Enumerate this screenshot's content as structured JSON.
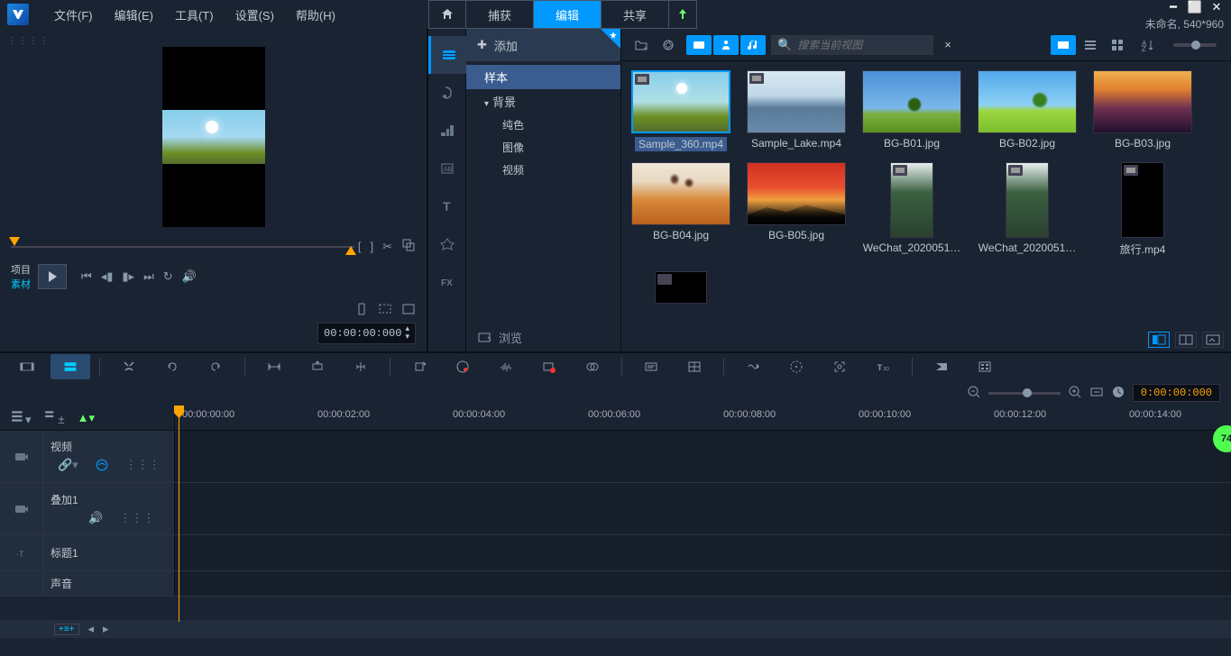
{
  "menubar": {
    "file": "文件(F)",
    "edit": "编辑(E)",
    "tools": "工具(T)",
    "settings": "设置(S)",
    "help": "帮助(H)"
  },
  "tabs": {
    "capture": "捕获",
    "edit": "编辑",
    "share": "共享"
  },
  "project_info": "未命名, 540*960",
  "preview": {
    "project_label": "项目",
    "clip_label": "素材",
    "timecode": "00:00:00:000"
  },
  "library": {
    "add_label": "添加",
    "browse_label": "浏览",
    "search_placeholder": "搜索当前视图",
    "tree": {
      "sample": "样本",
      "background": "背景",
      "solid_color": "纯色",
      "image": "图像",
      "video": "视频"
    },
    "items": [
      {
        "name": "Sample_360.mp4",
        "thumb": "thumb-sample360",
        "selected": true,
        "badge": true
      },
      {
        "name": "Sample_Lake.mp4",
        "thumb": "thumb-lake",
        "badge": true
      },
      {
        "name": "BG-B01.jpg",
        "thumb": "thumb-b01"
      },
      {
        "name": "BG-B02.jpg",
        "thumb": "thumb-b02"
      },
      {
        "name": "BG-B03.jpg",
        "thumb": "thumb-b03"
      },
      {
        "name": "BG-B04.jpg",
        "thumb": "thumb-b04"
      },
      {
        "name": "BG-B05.jpg",
        "thumb": "thumb-b05"
      },
      {
        "name": "WeChat_2020051…",
        "thumb": "thumb-wechat",
        "narrow": true,
        "badge": true
      },
      {
        "name": "WeChat_2020051…",
        "thumb": "thumb-wechat",
        "narrow": true,
        "badge": true
      },
      {
        "name": "旅行.mp4",
        "thumb": "thumb-travel",
        "narrow": true,
        "badge": true
      }
    ]
  },
  "timeline": {
    "zoom_timecode": "0:00:00:000",
    "ruler": [
      "00:00:00:00",
      "00:00:02:00",
      "00:00:04:00",
      "00:00:06:00",
      "00:00:08:00",
      "00:00:10:00",
      "00:00:12:00",
      "00:00:14:00"
    ],
    "tracks": {
      "video": "视频",
      "overlay": "叠加1",
      "title": "标题1",
      "audio": "声音"
    }
  },
  "floating_badge": "74"
}
